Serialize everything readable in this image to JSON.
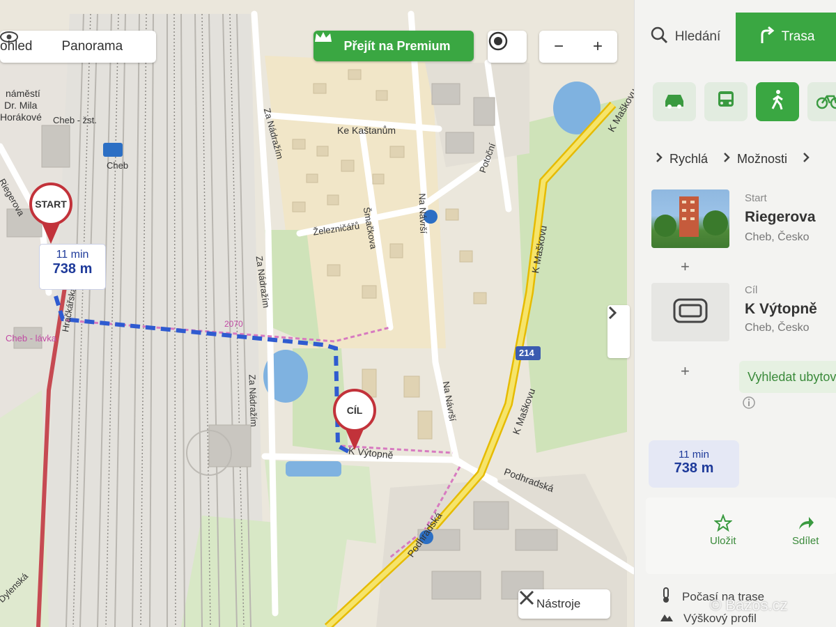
{
  "map_controls": {
    "view_prev_label": "ohled",
    "panorama_label": "Panorama",
    "premium_label": "Přejít na Premium",
    "zoom_out": "−",
    "zoom_in": "+",
    "tools_label": "Nástroje"
  },
  "markers": {
    "start_label": "START",
    "end_label": "CÍL",
    "tooltip_time": "11 min",
    "tooltip_distance": "738 m"
  },
  "map_labels": {
    "namesti_1": "náměstí",
    "namesti_2": "Dr. Mila",
    "namesti_3": "Horákové",
    "cheb_stop": "Cheb - žst.",
    "cheb_station": "Cheb",
    "riegerova": "Riegerova",
    "ke_kastanum": "Ke Kaštanům",
    "za_nadrazim_1": "Za Nádražím",
    "za_nadrazim_2": "Za Nádražím",
    "za_nadrazim_3": "Za Nádražím",
    "zeleznicaru": "Železničářů",
    "simackova": "Šmačkova",
    "na_navrsi_1": "Na Návrší",
    "na_navrsi_2": "Na Návrší",
    "potocni": "Potoční",
    "k_maskovu_1": "K Maškovu",
    "k_maskovu_2": "K Maškovu",
    "k_maskovu_3": "K Maškovu",
    "route_214": "214",
    "num_2070": "2070",
    "cheb_lavka": "Cheb - lávka",
    "hrackarska": "Hračkářská",
    "k_vytopne": "K Výtopně",
    "podhradska_1": "Podhradská",
    "podhradska_2": "Podhradská",
    "dylenska": "Dylenská",
    "k_maskovu_bottom": "ka"
  },
  "panel": {
    "tabs": [
      {
        "label": "Hledání",
        "icon": "search-icon"
      },
      {
        "label": "Trasa",
        "icon": "route-icon"
      }
    ],
    "modes": [
      {
        "name": "car",
        "icon": "car-icon"
      },
      {
        "name": "bus",
        "icon": "bus-icon"
      },
      {
        "name": "walk",
        "icon": "walk-icon",
        "active": true
      },
      {
        "name": "bike",
        "icon": "bike-icon"
      }
    ],
    "options": [
      {
        "label": "Rychlá"
      },
      {
        "label": "Možnosti"
      }
    ],
    "start": {
      "label": "Start",
      "name": "Riegerova",
      "place": "Cheb, Česko"
    },
    "end": {
      "label": "Cíl",
      "name": "K Výtopně",
      "place": "Cheb, Česko"
    },
    "accommodation_button": "Vyhledat ubytov",
    "summary_time": "11 min",
    "summary_distance": "738 m",
    "save_label": "Uložit",
    "share_label": "Sdílet",
    "weather_label": "Počasí na trase",
    "elevation_label": "Výškový profil",
    "watermark": "© Bazos.cz"
  }
}
